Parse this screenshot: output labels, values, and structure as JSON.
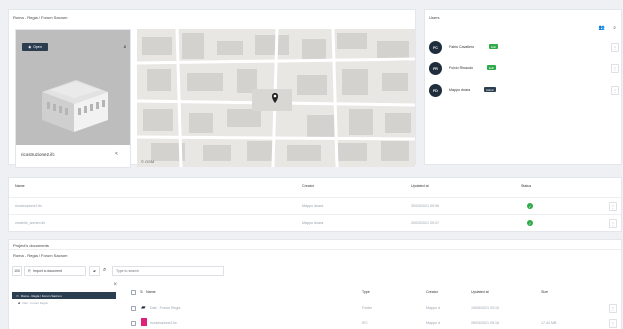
{
  "project": {
    "title": "Roma - Regia / Forum Sacrum",
    "open_label": "Open",
    "model_count": "2",
    "model_name": "ricostruzione2.ifc",
    "map_attribution": "© OSM"
  },
  "users": {
    "title": "Users",
    "items": [
      {
        "initials": "FC",
        "name": "Fabio Cavallero",
        "role": "Edit",
        "role_color": "#2faa4a"
      },
      {
        "initials": "FR",
        "name": "Fulvio Rinaudo",
        "role": "Edit",
        "role_color": "#2faa4a"
      },
      {
        "initials": "FD",
        "name": "Mappo dnara",
        "role": "Admin",
        "role_color": "#2b3e50"
      }
    ]
  },
  "models": {
    "headers": {
      "name": "Name",
      "creator": "Creator",
      "updated": "Updated at",
      "status": "Status"
    },
    "rows": [
      {
        "name": "ricostruzione2.ifc",
        "creator": "Mappo dnara",
        "updated": "30/03/2021 09:06"
      },
      {
        "name": "modello_archeo.ifc",
        "creator": "Mappo dnara",
        "updated": "25/03/2021 09:37"
      }
    ]
  },
  "docs": {
    "title": "Project's documents",
    "breadcrumb": "Roma - Regia / Forum Sacrum",
    "count": "100",
    "import_label": "Import a document",
    "search_placeholder": "Type to search",
    "tree_root": "Roma - Regia / Forum Sacrum",
    "tree_child": "Dati - Forum Regia",
    "headers": {
      "name": "Name",
      "type": "Type",
      "creator": "Creator",
      "updated": "Updated at",
      "size": "Size"
    },
    "rows": [
      {
        "name": "Dati - Forum Regia",
        "type": "Folder",
        "creator": "Mappo d",
        "updated": "19/05/2021 03:15",
        "size": ""
      },
      {
        "name": "ricostruzione2.ifc",
        "type": "IFC",
        "creator": "Mappo d",
        "updated": "26/03/2021 09:16",
        "size": "17.44 MB"
      }
    ]
  }
}
